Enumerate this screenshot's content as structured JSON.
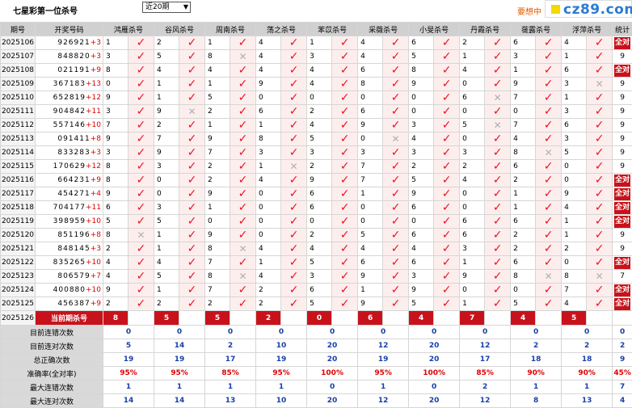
{
  "page_title": "七星彩第一位杀号",
  "select_value": "近20期",
  "promo_text": "要想中",
  "logo_text": "cz89.com",
  "headers": [
    "期号",
    "开奖号码",
    "鸿雁杀号",
    "谷风杀号",
    "周南杀号",
    "荡之杀号",
    "苯苡杀号",
    "采薇杀号",
    "小旻杀号",
    "丹霞杀号",
    "蓰露杀号",
    "浮萍杀号",
    "统计"
  ],
  "colors": {
    "hit": "#e11122",
    "miss": "#b0b0b0",
    "banner": "#c8121b",
    "value": "#1840a8",
    "percent": "#dd0000"
  },
  "rows": [
    {
      "p": "2025106",
      "n": "926921",
      "s": "+3",
      "k": [
        "1",
        "2",
        "1",
        "4",
        "1",
        "4",
        "6",
        "2",
        "6",
        "4"
      ],
      "r": [
        1,
        1,
        1,
        1,
        1,
        1,
        1,
        1,
        1,
        1
      ],
      "st": "全对"
    },
    {
      "p": "2025107",
      "n": "848820",
      "s": "+3",
      "k": [
        "3",
        "5",
        "8",
        "4",
        "3",
        "4",
        "5",
        "1",
        "3",
        "1"
      ],
      "r": [
        1,
        1,
        0,
        1,
        1,
        1,
        1,
        1,
        1,
        1
      ],
      "st": "9"
    },
    {
      "p": "2025108",
      "n": "021191",
      "s": "+9",
      "k": [
        "8",
        "4",
        "4",
        "4",
        "4",
        "6",
        "8",
        "4",
        "1",
        "6"
      ],
      "r": [
        1,
        1,
        1,
        1,
        1,
        1,
        1,
        1,
        1,
        1
      ],
      "st": "全对"
    },
    {
      "p": "2025109",
      "n": "367183",
      "s": "+13",
      "k": [
        "0",
        "1",
        "1",
        "9",
        "4",
        "8",
        "9",
        "0",
        "9",
        "3"
      ],
      "r": [
        1,
        1,
        1,
        1,
        1,
        1,
        1,
        1,
        1,
        0
      ],
      "st": "9"
    },
    {
      "p": "2025110",
      "n": "652819",
      "s": "+12",
      "k": [
        "9",
        "1",
        "5",
        "0",
        "0",
        "0",
        "0",
        "6",
        "7",
        "1"
      ],
      "r": [
        1,
        1,
        1,
        1,
        1,
        1,
        1,
        0,
        1,
        1
      ],
      "st": "9"
    },
    {
      "p": "2025111",
      "n": "904842",
      "s": "+11",
      "k": [
        "3",
        "9",
        "2",
        "6",
        "2",
        "6",
        "0",
        "0",
        "0",
        "3"
      ],
      "r": [
        1,
        0,
        1,
        1,
        1,
        1,
        1,
        1,
        1,
        1
      ],
      "st": "9"
    },
    {
      "p": "2025112",
      "n": "557146",
      "s": "+10",
      "k": [
        "7",
        "2",
        "1",
        "1",
        "4",
        "9",
        "3",
        "5",
        "7",
        "6"
      ],
      "r": [
        1,
        1,
        1,
        1,
        1,
        1,
        1,
        0,
        1,
        1
      ],
      "st": "9"
    },
    {
      "p": "2025113",
      "n": "091411",
      "s": "+8",
      "k": [
        "9",
        "7",
        "9",
        "8",
        "5",
        "0",
        "4",
        "0",
        "4",
        "3"
      ],
      "r": [
        1,
        1,
        1,
        1,
        1,
        0,
        1,
        1,
        1,
        1
      ],
      "st": "9"
    },
    {
      "p": "2025114",
      "n": "833283",
      "s": "+3",
      "k": [
        "3",
        "9",
        "7",
        "3",
        "3",
        "3",
        "3",
        "3",
        "8",
        "5"
      ],
      "r": [
        1,
        1,
        1,
        1,
        1,
        1,
        1,
        1,
        0,
        1
      ],
      "st": "9"
    },
    {
      "p": "2025115",
      "n": "170629",
      "s": "+12",
      "k": [
        "8",
        "3",
        "2",
        "1",
        "2",
        "7",
        "2",
        "2",
        "6",
        "0"
      ],
      "r": [
        1,
        1,
        1,
        0,
        1,
        1,
        1,
        1,
        1,
        1
      ],
      "st": "9"
    },
    {
      "p": "2025116",
      "n": "664231",
      "s": "+9",
      "k": [
        "8",
        "0",
        "2",
        "4",
        "9",
        "7",
        "5",
        "4",
        "2",
        "0"
      ],
      "r": [
        1,
        1,
        1,
        1,
        1,
        1,
        1,
        1,
        1,
        1
      ],
      "st": "全对"
    },
    {
      "p": "2025117",
      "n": "454271",
      "s": "+4",
      "k": [
        "9",
        "0",
        "9",
        "0",
        "6",
        "1",
        "9",
        "0",
        "1",
        "9"
      ],
      "r": [
        1,
        1,
        1,
        1,
        1,
        1,
        1,
        1,
        1,
        1
      ],
      "st": "全对"
    },
    {
      "p": "2025118",
      "n": "704177",
      "s": "+11",
      "k": [
        "6",
        "3",
        "1",
        "0",
        "6",
        "0",
        "6",
        "0",
        "1",
        "4"
      ],
      "r": [
        1,
        1,
        1,
        1,
        1,
        1,
        1,
        1,
        1,
        1
      ],
      "st": "全对"
    },
    {
      "p": "2025119",
      "n": "398959",
      "s": "+10",
      "k": [
        "5",
        "5",
        "0",
        "0",
        "0",
        "0",
        "0",
        "6",
        "6",
        "1"
      ],
      "r": [
        1,
        1,
        1,
        1,
        1,
        1,
        1,
        1,
        1,
        1
      ],
      "st": "全对"
    },
    {
      "p": "2025120",
      "n": "851196",
      "s": "+8",
      "k": [
        "8",
        "1",
        "9",
        "0",
        "2",
        "5",
        "6",
        "6",
        "2",
        "1"
      ],
      "r": [
        0,
        1,
        1,
        1,
        1,
        1,
        1,
        1,
        1,
        1
      ],
      "st": "9"
    },
    {
      "p": "2025121",
      "n": "848145",
      "s": "+3",
      "k": [
        "2",
        "1",
        "8",
        "4",
        "4",
        "4",
        "4",
        "3",
        "2",
        "2"
      ],
      "r": [
        1,
        1,
        0,
        1,
        1,
        1,
        1,
        1,
        1,
        1
      ],
      "st": "9"
    },
    {
      "p": "2025122",
      "n": "835265",
      "s": "+10",
      "k": [
        "4",
        "4",
        "7",
        "1",
        "5",
        "6",
        "6",
        "1",
        "6",
        "0"
      ],
      "r": [
        1,
        1,
        1,
        1,
        1,
        1,
        1,
        1,
        1,
        1
      ],
      "st": "全对"
    },
    {
      "p": "2025123",
      "n": "806579",
      "s": "+7",
      "k": [
        "4",
        "5",
        "8",
        "4",
        "3",
        "9",
        "3",
        "9",
        "8",
        "8"
      ],
      "r": [
        1,
        1,
        0,
        1,
        1,
        1,
        1,
        1,
        0,
        0
      ],
      "st": "7"
    },
    {
      "p": "2025124",
      "n": "400880",
      "s": "+10",
      "k": [
        "9",
        "1",
        "7",
        "2",
        "6",
        "1",
        "9",
        "0",
        "0",
        "7"
      ],
      "r": [
        1,
        1,
        1,
        1,
        1,
        1,
        1,
        1,
        1,
        1
      ],
      "st": "全对"
    },
    {
      "p": "2025125",
      "n": "456387",
      "s": "+9",
      "k": [
        "2",
        "2",
        "2",
        "2",
        "5",
        "9",
        "5",
        "1",
        "5",
        "4"
      ],
      "r": [
        1,
        1,
        1,
        1,
        1,
        1,
        1,
        1,
        1,
        1
      ],
      "st": "全对"
    }
  ],
  "current": {
    "period": "2025126",
    "label": "当前期杀号",
    "kills": [
      "8",
      "5",
      "5",
      "2",
      "0",
      "6",
      "4",
      "7",
      "4",
      "5"
    ]
  },
  "summary": [
    {
      "label": "目前连错次数",
      "vals": [
        "0",
        "0",
        "0",
        "0",
        "0",
        "0",
        "0",
        "0",
        "0",
        "0",
        "0"
      ],
      "pct": false
    },
    {
      "label": "目前连对次数",
      "vals": [
        "5",
        "14",
        "2",
        "10",
        "20",
        "12",
        "20",
        "12",
        "2",
        "2",
        "2"
      ],
      "pct": false
    },
    {
      "label": "总正确次数",
      "vals": [
        "19",
        "19",
        "17",
        "19",
        "20",
        "19",
        "20",
        "17",
        "18",
        "18",
        "9"
      ],
      "pct": false
    },
    {
      "label": "准确率(全对率)",
      "vals": [
        "95%",
        "95%",
        "85%",
        "95%",
        "100%",
        "95%",
        "100%",
        "85%",
        "90%",
        "90%",
        "45%"
      ],
      "pct": true
    },
    {
      "label": "最大连错次数",
      "vals": [
        "1",
        "1",
        "1",
        "1",
        "0",
        "1",
        "0",
        "2",
        "1",
        "1",
        "7"
      ],
      "pct": false
    },
    {
      "label": "最大连对次数",
      "vals": [
        "14",
        "14",
        "13",
        "10",
        "20",
        "12",
        "20",
        "12",
        "8",
        "13",
        "4"
      ],
      "pct": false
    }
  ]
}
